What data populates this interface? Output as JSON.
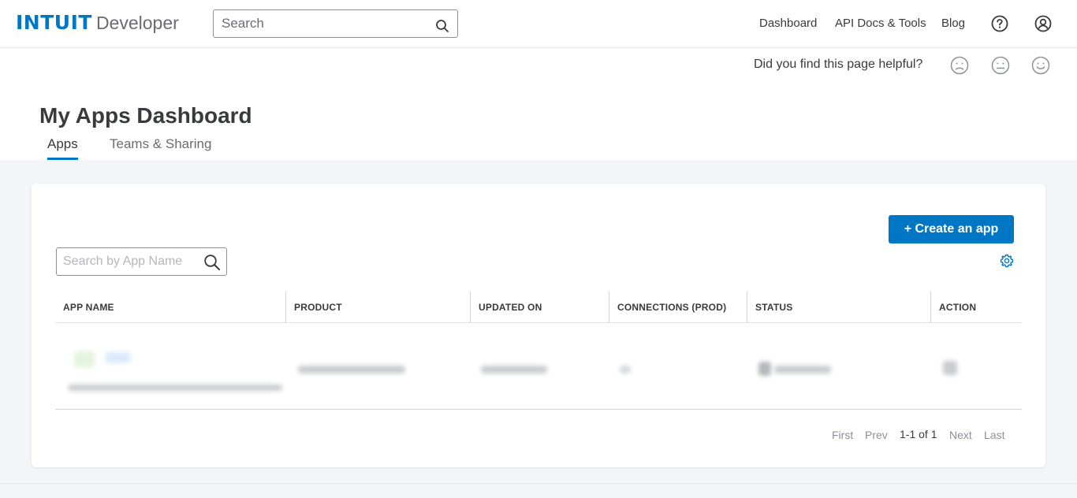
{
  "header": {
    "brand": "INTUIT",
    "brand_sub": "Developer",
    "search_placeholder": "Search",
    "nav": {
      "dashboard": "Dashboard",
      "api_docs": "API Docs & Tools",
      "blog": "Blog"
    }
  },
  "feedback": {
    "question": "Did you find this page helpful?"
  },
  "page": {
    "title": "My Apps Dashboard",
    "tabs": [
      {
        "label": "Apps",
        "active": true
      },
      {
        "label": "Teams & Sharing",
        "active": false
      }
    ]
  },
  "apps_panel": {
    "create_button": "+ Create an app",
    "search_placeholder": "Search by App Name",
    "columns": [
      "APP NAME",
      "PRODUCT",
      "UPDATED ON",
      "CONNECTIONS (PROD)",
      "STATUS",
      "ACTION"
    ],
    "pagination": {
      "first": "First",
      "prev": "Prev",
      "range": "1-1 of 1",
      "next": "Next",
      "last": "Last"
    }
  },
  "colors": {
    "accent": "#0077c5",
    "text": "#393a3d",
    "muted": "#8d9096",
    "background": "#f4f5f8"
  }
}
